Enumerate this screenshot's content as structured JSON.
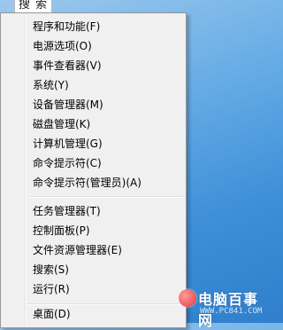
{
  "partial_label": "搜 索",
  "menu": {
    "group1": [
      "程序和功能(F)",
      "电源选项(O)",
      "事件查看器(V)",
      "系统(Y)",
      "设备管理器(M)",
      "磁盘管理(K)",
      "计算机管理(G)",
      "命令提示符(C)",
      "命令提示符(管理员)(A)"
    ],
    "group2": [
      "任务管理器(T)",
      "控制面板(P)",
      "文件资源管理器(E)",
      "搜索(S)",
      "运行(R)"
    ],
    "group3": [
      "桌面(D)"
    ]
  },
  "watermark": {
    "title": "电脑百事网",
    "url": "WWW.PC841.COM"
  },
  "colors": {
    "menu_bg": "#f0f0f0",
    "desktop_blue": "#3d8fd8"
  }
}
